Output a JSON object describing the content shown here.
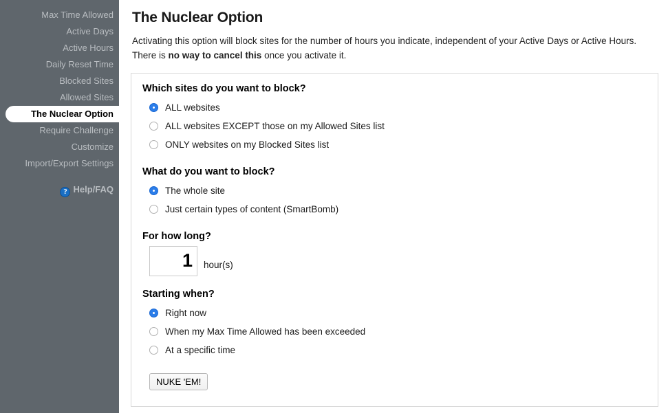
{
  "sidebar": {
    "items": [
      {
        "label": "Max Time Allowed",
        "active": false
      },
      {
        "label": "Active Days",
        "active": false
      },
      {
        "label": "Active Hours",
        "active": false
      },
      {
        "label": "Daily Reset Time",
        "active": false
      },
      {
        "label": "Blocked Sites",
        "active": false
      },
      {
        "label": "Allowed Sites",
        "active": false
      },
      {
        "label": "The Nuclear Option",
        "active": true
      },
      {
        "label": "Require Challenge",
        "active": false
      },
      {
        "label": "Customize",
        "active": false
      },
      {
        "label": "Import/Export Settings",
        "active": false
      }
    ],
    "help": {
      "label": "Help/FAQ",
      "icon": "question-mark-circle-icon",
      "icon_glyph": "?",
      "icon_color": "#1a6fc4"
    },
    "background_color": "#5f666c",
    "text_color": "#b9bdc1",
    "active_background": "#ffffff",
    "active_text_color": "#000000"
  },
  "header": {
    "title": "The Nuclear Option",
    "description_part1": "Activating this option will block sites for the number of hours you indicate, independent of your Active Days or Active Hours. There is ",
    "description_bold": "no way to cancel this",
    "description_part2": " once you activate it."
  },
  "form": {
    "sections": [
      {
        "title": "Which sites do you want to block?",
        "options": [
          {
            "label": "ALL websites",
            "checked": true
          },
          {
            "label": "ALL websites EXCEPT those on my Allowed Sites list",
            "checked": false
          },
          {
            "label": "ONLY websites on my Blocked Sites list",
            "checked": false
          }
        ]
      },
      {
        "title": "What do you want to block?",
        "options": [
          {
            "label": "The whole site",
            "checked": true
          },
          {
            "label": "Just certain types of content (SmartBomb)",
            "checked": false
          }
        ]
      }
    ],
    "duration": {
      "title": "For how long?",
      "value": "1",
      "unit_label": "hour(s)"
    },
    "starting": {
      "title": "Starting when?",
      "options": [
        {
          "label": "Right now",
          "checked": true
        },
        {
          "label": "When my Max Time Allowed has been exceeded",
          "checked": false
        },
        {
          "label": "At a specific time",
          "checked": false
        }
      ]
    },
    "submit_label": "NUKE 'EM!",
    "accent_color": "#2b7de9"
  }
}
